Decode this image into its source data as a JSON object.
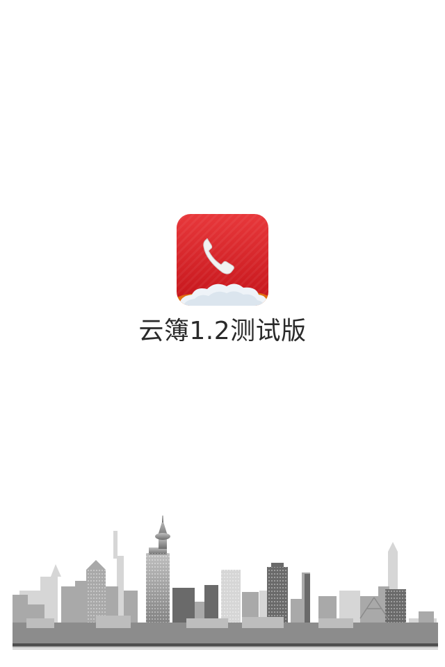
{
  "splash": {
    "app_name": "云簿1.2测试版",
    "icon": "phone-handset-icon",
    "background_image": "city-skyline-illustration"
  },
  "colors": {
    "background": "#ffffff",
    "icon_red": "#d81e1e",
    "title_text": "#2a2a2a",
    "skyline_gray": "#9a9a9a"
  }
}
